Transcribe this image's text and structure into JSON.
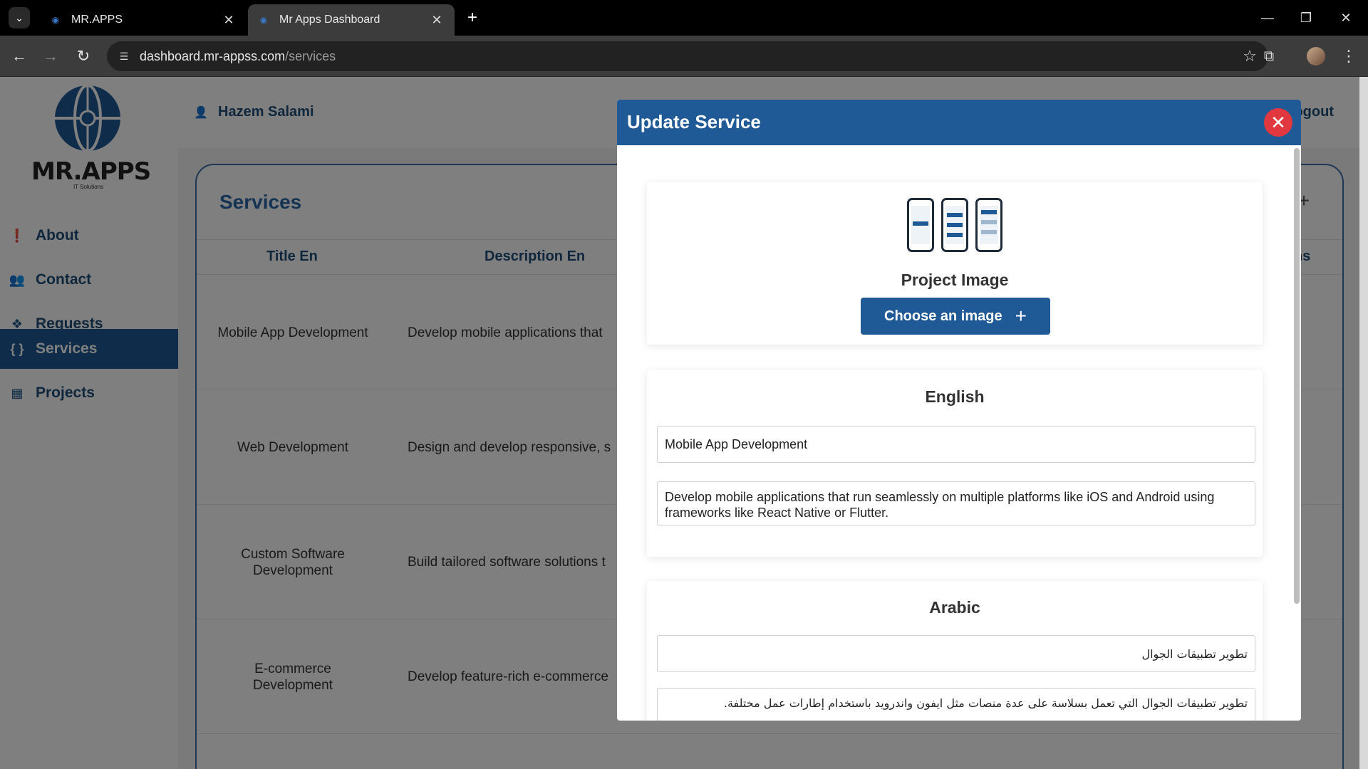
{
  "browser": {
    "tabs": [
      {
        "title": "MR.APPS"
      },
      {
        "title": "Mr Apps Dashboard"
      }
    ],
    "url_host": "dashboard.mr-appss.com",
    "url_path": "/services"
  },
  "sidebar": {
    "logo_text": "MR.APPS",
    "logo_sub": "IT Solutions",
    "items": [
      {
        "label": "About",
        "icon": "info-icon"
      },
      {
        "label": "Contact",
        "icon": "users-icon"
      },
      {
        "label": "Requests",
        "icon": "requests-icon"
      },
      {
        "label": "Services",
        "icon": "braces-icon",
        "active": true
      },
      {
        "label": "Projects",
        "icon": "grid-icon"
      }
    ]
  },
  "topbar": {
    "user_name": "Hazem Salami",
    "logout_label": "ogout"
  },
  "services": {
    "title": "Services",
    "columns": [
      "Title En",
      "Description En",
      "ns"
    ],
    "rows": [
      {
        "title": "Mobile App Development",
        "description": "Develop mobile applications that"
      },
      {
        "title": "Web Development",
        "description": "Design and develop responsive, s"
      },
      {
        "title": "Custom Software Development",
        "description": "Build tailored software solutions t"
      },
      {
        "title": "E-commerce Development",
        "description": "Develop feature-rich e-commerce"
      }
    ]
  },
  "modal": {
    "title": "Update Service",
    "image_section": {
      "label": "Project Image",
      "button_label": "Choose an image"
    },
    "english": {
      "heading": "English",
      "title_value": "Mobile App Development",
      "description_value": "Develop mobile applications that run seamlessly on multiple platforms like iOS and Android using frameworks like React Native or Flutter."
    },
    "arabic": {
      "heading": "Arabic",
      "title_value": "تطوير تطبيقات الجوال",
      "description_value": "تطوير تطبيقات الجوال التي تعمل بسلاسة على عدة منصات مثل ايفون واندرويد باستخدام إطارات عمل مختلفة."
    }
  },
  "colors": {
    "brand": "#1f5a96",
    "close": "#e0383e"
  }
}
